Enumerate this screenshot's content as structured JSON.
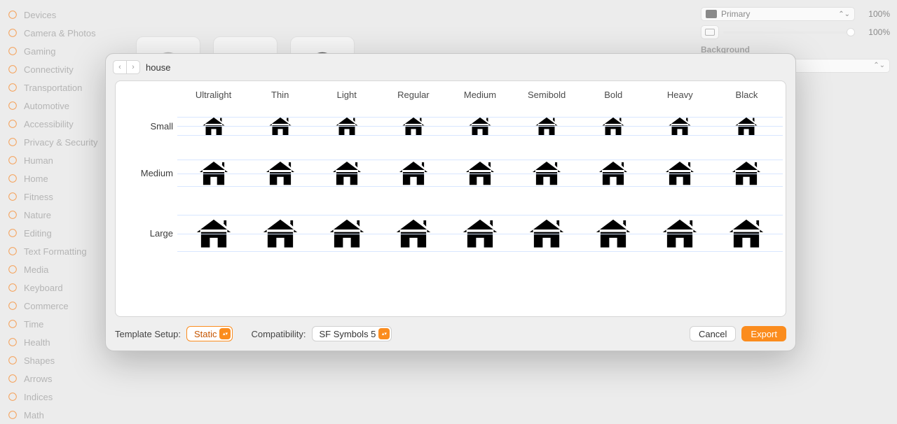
{
  "sidebar": {
    "items": [
      {
        "label": "Devices",
        "icon": "device"
      },
      {
        "label": "Camera & Photos",
        "icon": "camera"
      },
      {
        "label": "Gaming",
        "icon": "gamepad"
      },
      {
        "label": "Connectivity",
        "icon": "wifi"
      },
      {
        "label": "Transportation",
        "icon": "car"
      },
      {
        "label": "Automotive",
        "icon": "steering"
      },
      {
        "label": "Accessibility",
        "icon": "person"
      },
      {
        "label": "Privacy & Security",
        "icon": "lock"
      },
      {
        "label": "Human",
        "icon": "human"
      },
      {
        "label": "Home",
        "icon": "home"
      },
      {
        "label": "Fitness",
        "icon": "bolt"
      },
      {
        "label": "Nature",
        "icon": "leaf"
      },
      {
        "label": "Editing",
        "icon": "slider"
      },
      {
        "label": "Text Formatting",
        "icon": "text"
      },
      {
        "label": "Media",
        "icon": "play"
      },
      {
        "label": "Keyboard",
        "icon": "keyboard"
      },
      {
        "label": "Commerce",
        "icon": "cart"
      },
      {
        "label": "Time",
        "icon": "clock"
      },
      {
        "label": "Health",
        "icon": "heart"
      },
      {
        "label": "Shapes",
        "icon": "shape"
      },
      {
        "label": "Arrows",
        "icon": "arrow"
      },
      {
        "label": "Indices",
        "icon": "index"
      },
      {
        "label": "Math",
        "icon": "math"
      }
    ]
  },
  "inspector": {
    "rendering_label": "Primary",
    "rendering_pct": "100%",
    "secondary_pct": "100%",
    "section": "Background"
  },
  "sheet": {
    "title": "house",
    "weights": [
      "Ultralight",
      "Thin",
      "Light",
      "Regular",
      "Medium",
      "Semibold",
      "Bold",
      "Heavy",
      "Black"
    ],
    "weight_class": [
      "w-ul",
      "w-th",
      "w-li",
      "w-re",
      "w-me",
      "w-sb",
      "w-bo",
      "w-he",
      "w-bl"
    ],
    "scales": [
      "Small",
      "Medium",
      "Large"
    ],
    "scale_class": [
      "sz-s",
      "sz-m",
      "sz-l"
    ],
    "template_setup_label": "Template Setup:",
    "template_setup_value": "Static",
    "compat_label": "Compatibility:",
    "compat_value": "SF Symbols 5",
    "cancel": "Cancel",
    "export": "Export"
  }
}
